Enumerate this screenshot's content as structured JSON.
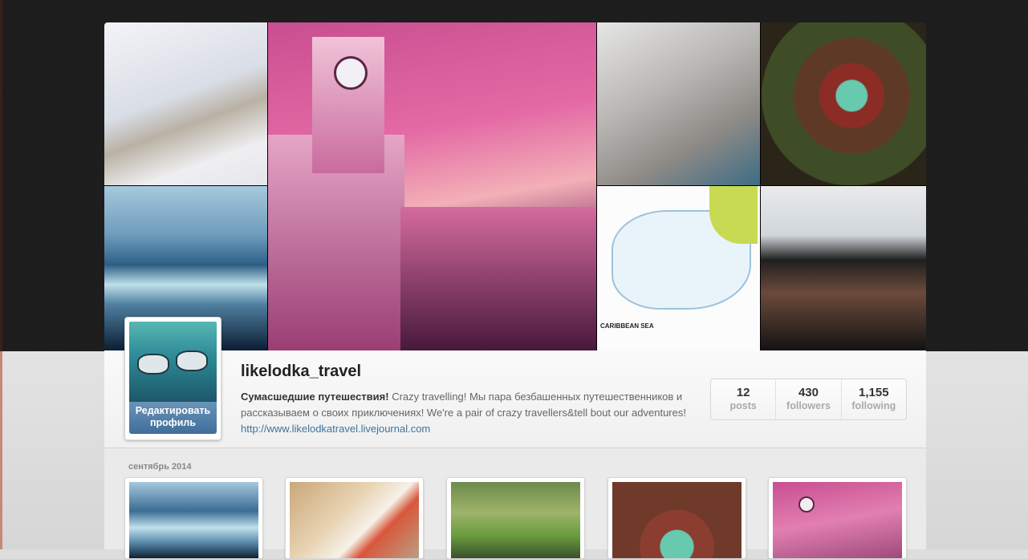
{
  "profile": {
    "username": "likelodka_travel",
    "bio_bold": "Сумасшедшие путешествия!",
    "bio_text": " Crazy travelling! Мы пара безбашенных путешественников и рассказываем о своих приключениях! We're a pair of crazy travellers&tell bout our adventures! ",
    "website": "http://www.likelodkatravel.livejournal.com",
    "edit_button": "Редактировать профиль"
  },
  "stats": [
    {
      "value": "12",
      "label": "posts"
    },
    {
      "value": "430",
      "label": "followers"
    },
    {
      "value": "1,155",
      "label": "following"
    }
  ],
  "mosaic": {
    "map_label": "CARIBBEAN SEA"
  },
  "feed": {
    "month": "сентябрь 2014"
  },
  "colors": {
    "link": "#3f729b",
    "edit_button": "#4f7ea8",
    "header_bg": "#1c1c1c"
  }
}
